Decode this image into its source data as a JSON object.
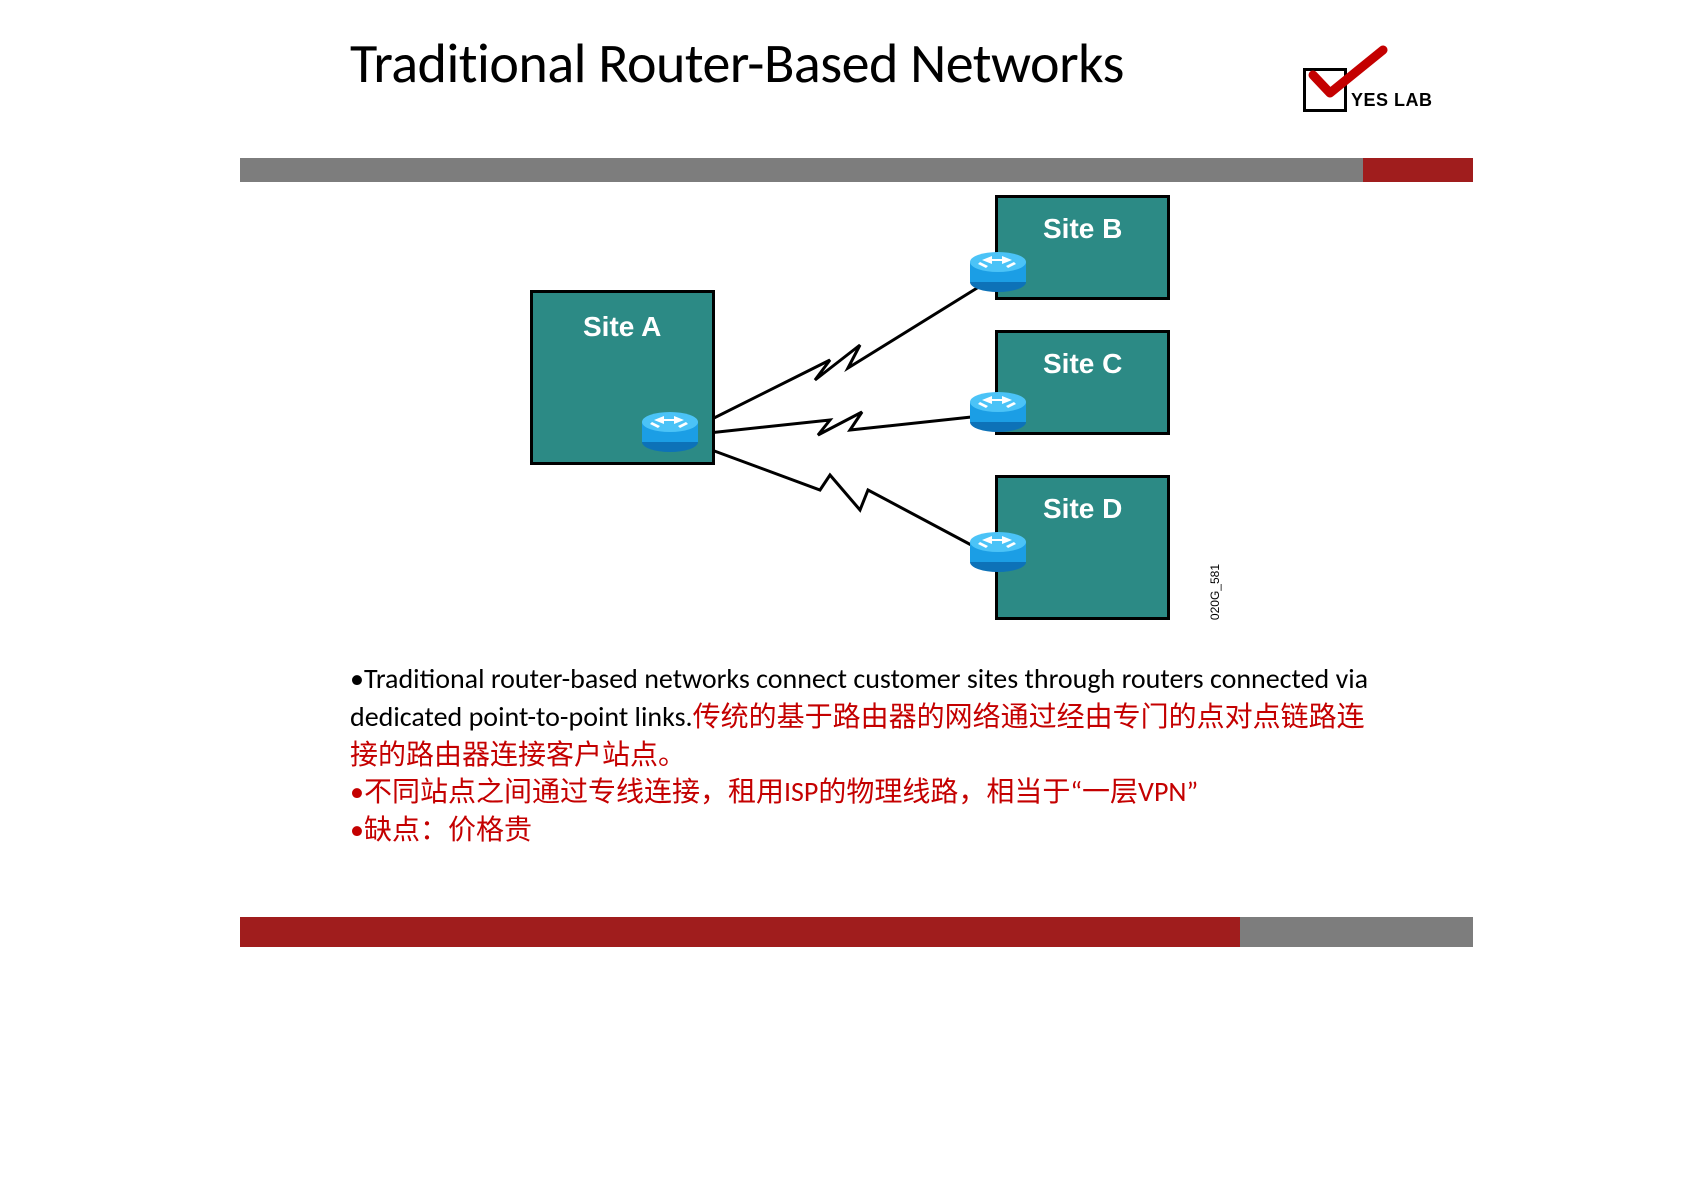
{
  "title": "Traditional Router-Based Networks",
  "logo_text": "YES LAB",
  "sites": {
    "A": "Site A",
    "B": "Site B",
    "C": "Site C",
    "D": "Site D"
  },
  "figure_ref": "020G_581",
  "bullets": {
    "b1_en": "Traditional router-based networks connect customer sites through routers connected via dedicated point-to-point links.",
    "b1_zh": "传统的基于路由器的网络通过经由专门的点对点链路连接的路由器连接客户站点。",
    "b2": "不同站点之间通过专线连接，租用ISP的物理线路，相当于“一层VPN”",
    "b3": "缺点：价格贵"
  },
  "colors": {
    "site_fill": "#2c8a85",
    "brand_red": "#a01d1d",
    "bar_grey": "#7d7d7d",
    "text_red": "#c40000",
    "router_blue": "#1b9ee5"
  }
}
